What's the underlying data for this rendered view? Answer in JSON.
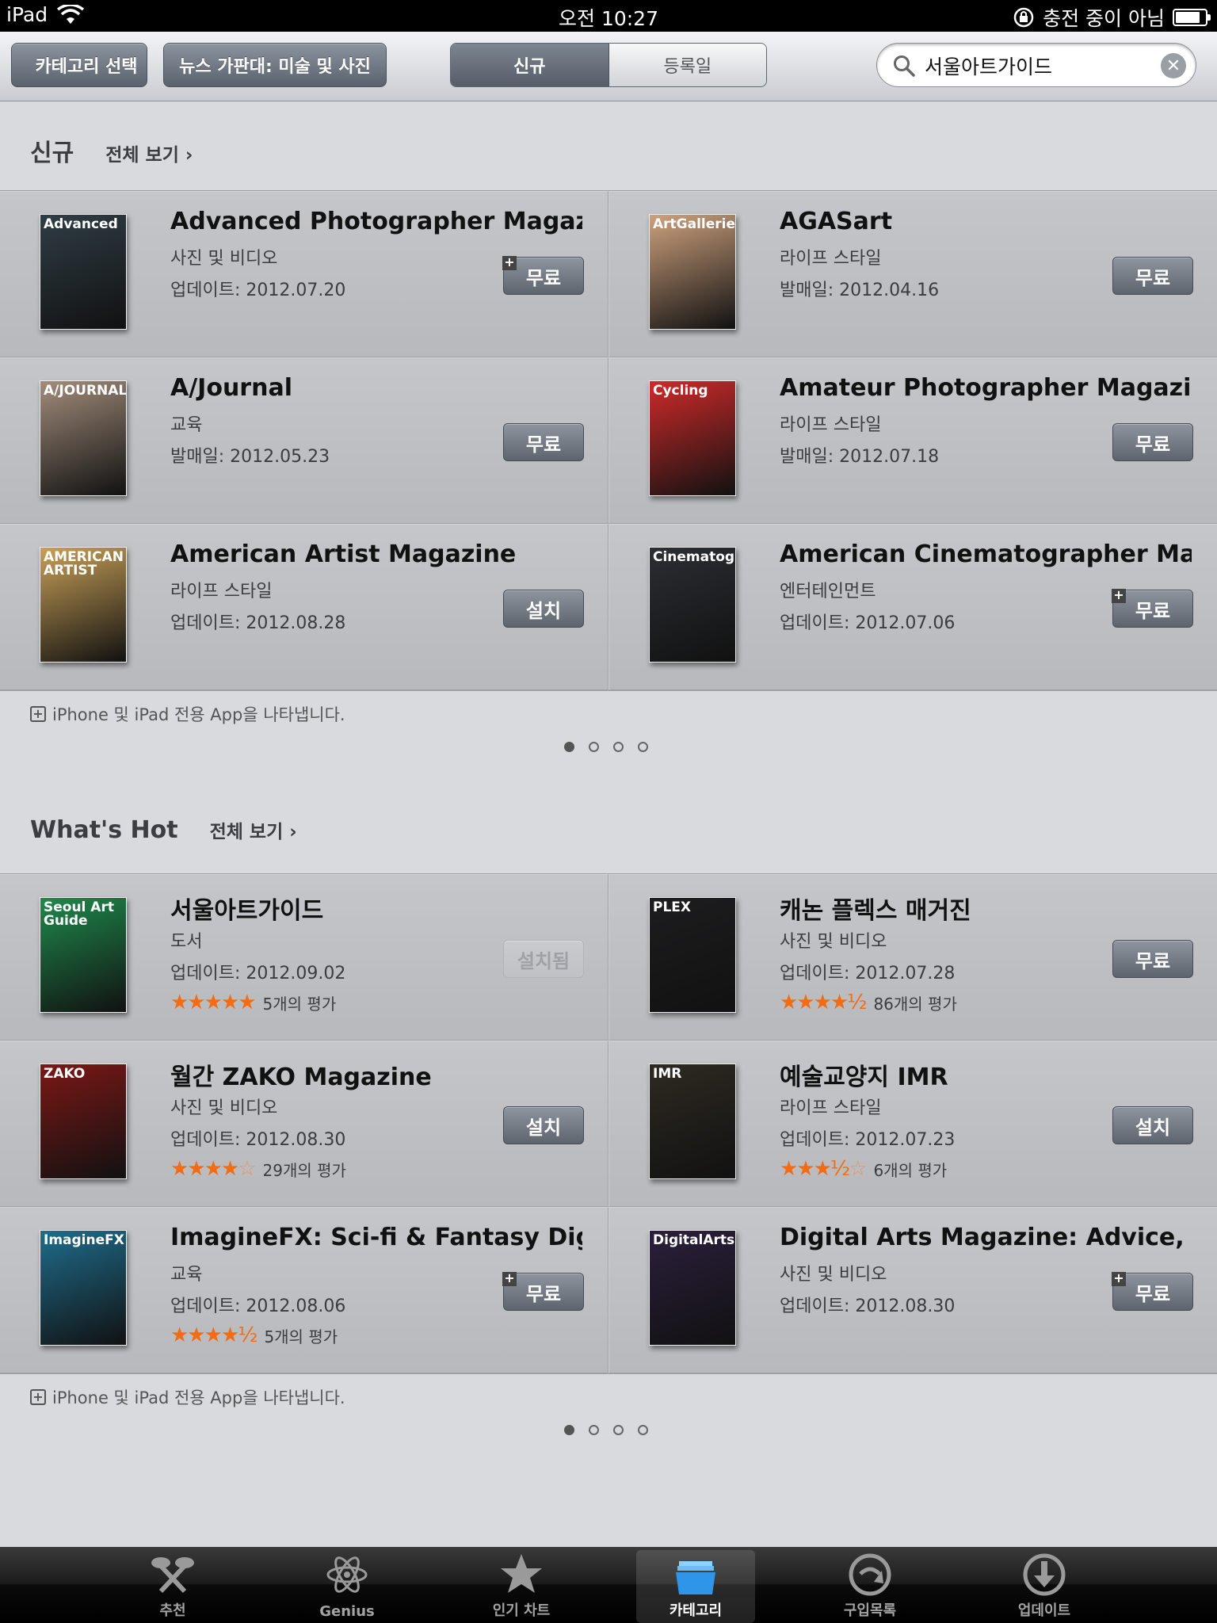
{
  "status_bar": {
    "device": "iPad",
    "time": "오전 10:27",
    "charging": "충전 중이 아님"
  },
  "nav": {
    "back_label": "카테고리 선택",
    "category_label": "뉴스 가판대: 미술 및 사진",
    "segments": [
      "신규",
      "등록일"
    ],
    "search_value": "서울아트가이드"
  },
  "section_new": {
    "title": "신규",
    "see_all": "전체 보기 ›",
    "footnote": "iPhone 및 iPad 전용 App을 나타냅니다.",
    "items": [
      {
        "name": "Advanced Photographer Magazi...",
        "category": "사진 및 비디오",
        "date_label": "업데이트:",
        "date": "2012.07.20",
        "price": "무료",
        "universal": true,
        "cover_title": "Advanced",
        "cover_color": "#2f3d45"
      },
      {
        "name": "AGASart",
        "category": "라이프 스타일",
        "date_label": "발매일:",
        "date": "2012.04.16",
        "price": "무료",
        "universal": false,
        "cover_title": "ArtGalleries",
        "cover_color": "#cfa27e"
      },
      {
        "name": "A/Journal",
        "category": "교육",
        "date_label": "발매일:",
        "date": "2012.05.23",
        "price": "무료",
        "universal": false,
        "cover_title": "A/JOURNAL",
        "cover_color": "#a28d7b"
      },
      {
        "name": "Amateur Photographer Magazine",
        "category": "라이프 스타일",
        "date_label": "발매일:",
        "date": "2012.07.18",
        "price": "무료",
        "universal": false,
        "cover_title": "Cycling",
        "cover_color": "#d02a2a"
      },
      {
        "name": "American Artist Magazine",
        "category": "라이프 스타일",
        "date_label": "업데이트:",
        "date": "2012.08.28",
        "price": "설치",
        "universal": false,
        "cover_title": "AMERICAN ARTIST",
        "cover_color": "#c9a158"
      },
      {
        "name": "American Cinematographer Ma...",
        "category": "엔터테인먼트",
        "date_label": "업데이트:",
        "date": "2012.07.06",
        "price": "무료",
        "universal": true,
        "cover_title": "Cinematographer",
        "cover_color": "#2b2e33"
      }
    ]
  },
  "section_hot": {
    "title": "What's Hot",
    "see_all": "전체 보기 ›",
    "footnote": "iPhone 및 iPad 전용 App을 나타냅니다.",
    "items": [
      {
        "name": "서울아트가이드",
        "category": "도서",
        "date_label": "업데이트:",
        "date": "2012.09.02",
        "price": "설치됨",
        "installed": true,
        "universal": false,
        "stars": "★★★★★",
        "empty_stars": "",
        "rating_count": "5개의 평가",
        "cover_title": "Seoul Art Guide",
        "cover_color": "#1f8a4c"
      },
      {
        "name": "캐논 플렉스 매거진",
        "category": "사진 및 비디오",
        "date_label": "업데이트:",
        "date": "2012.07.28",
        "price": "무료",
        "universal": false,
        "stars": "★★★★½",
        "empty_stars": "",
        "rating_count": "86개의 평가",
        "cover_title": "PLEX",
        "cover_color": "#1d1d1f"
      },
      {
        "name": "월간 ZAKO Magazine",
        "category": "사진 및 비디오",
        "date_label": "업데이트:",
        "date": "2012.08.30",
        "price": "설치",
        "universal": false,
        "stars": "★★★★",
        "empty_stars": "☆",
        "rating_count": "29개의 평가",
        "cover_title": "ZAKO",
        "cover_color": "#7b1816"
      },
      {
        "name": "예술교양지 IMR",
        "category": "라이프 스타일",
        "date_label": "업데이트:",
        "date": "2012.07.23",
        "price": "설치",
        "universal": false,
        "stars": "★★★½",
        "empty_stars": "☆",
        "rating_count": "6개의 평가",
        "cover_title": "IMR",
        "cover_color": "#2e2a22"
      },
      {
        "name": "ImagineFX: Sci-fi & Fantasy Digi...",
        "category": "교육",
        "date_label": "업데이트:",
        "date": "2012.08.06",
        "price": "무료",
        "universal": true,
        "stars": "★★★★½",
        "empty_stars": "",
        "rating_count": "5개의 평가",
        "cover_title": "ImagineFX",
        "cover_color": "#1f6d8c"
      },
      {
        "name": "Digital Arts Magazine: Advice, T...",
        "category": "사진 및 비디오",
        "date_label": "업데이트:",
        "date": "2012.08.30",
        "price": "무료",
        "universal": true,
        "stars": "",
        "empty_stars": "",
        "rating_count": "",
        "cover_title": "DigitalArts",
        "cover_color": "#2b1f3c"
      }
    ]
  },
  "tabs": [
    {
      "label": "추천",
      "icon": "featured-icon",
      "active": false
    },
    {
      "label": "Genius",
      "icon": "genius-icon",
      "active": false
    },
    {
      "label": "인기 차트",
      "icon": "top-charts-icon",
      "active": false
    },
    {
      "label": "카테고리",
      "icon": "categories-icon",
      "active": true
    },
    {
      "label": "구입목록",
      "icon": "purchased-icon",
      "active": false
    },
    {
      "label": "업데이트",
      "icon": "updates-icon",
      "active": false
    }
  ],
  "colors": {
    "accent_star": "#f36b12",
    "button_dark": "#5d646e",
    "background": "#d9dadd"
  }
}
